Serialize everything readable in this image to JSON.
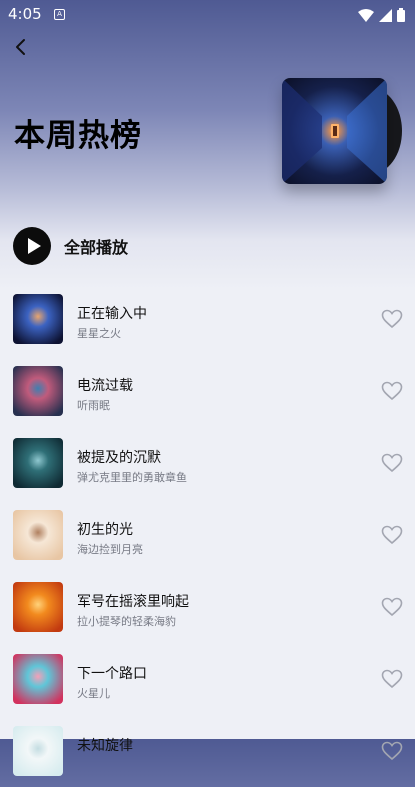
{
  "status_bar": {
    "time": "4:05",
    "app_icon": "A"
  },
  "page": {
    "title": "本周热榜"
  },
  "play_all": {
    "label": "全部播放"
  },
  "songs": [
    {
      "title": "正在输入中",
      "artist": "星星之火",
      "thumb_colors": [
        "#0d1232",
        "#3c63c2",
        "#e8a56e"
      ]
    },
    {
      "title": "电流过载",
      "artist": "听雨眠",
      "thumb_colors": [
        "#27304f",
        "#c05b7c",
        "#3f7fb0"
      ]
    },
    {
      "title": "被提及的沉默",
      "artist": "弹尤克里里的勇敢章鱼",
      "thumb_colors": [
        "#0f2a33",
        "#2f6f77",
        "#8fc8d0"
      ]
    },
    {
      "title": "初生的光",
      "artist": "海边捡到月亮",
      "thumb_colors": [
        "#e8c6a4",
        "#f6e7d6",
        "#b08060"
      ]
    },
    {
      "title": "军号在摇滚里响起",
      "artist": "拉小提琴的轻柔海豹",
      "thumb_colors": [
        "#c23a10",
        "#f28a1e",
        "#ffd27a"
      ]
    },
    {
      "title": "下一个路口",
      "artist": "火星儿",
      "thumb_colors": [
        "#d2325e",
        "#5fc6d8",
        "#f4a0b8"
      ]
    },
    {
      "title": "未知旋律",
      "artist": "",
      "thumb_colors": [
        "#d7ecef",
        "#f2f7f8",
        "#c4dde2"
      ]
    }
  ]
}
